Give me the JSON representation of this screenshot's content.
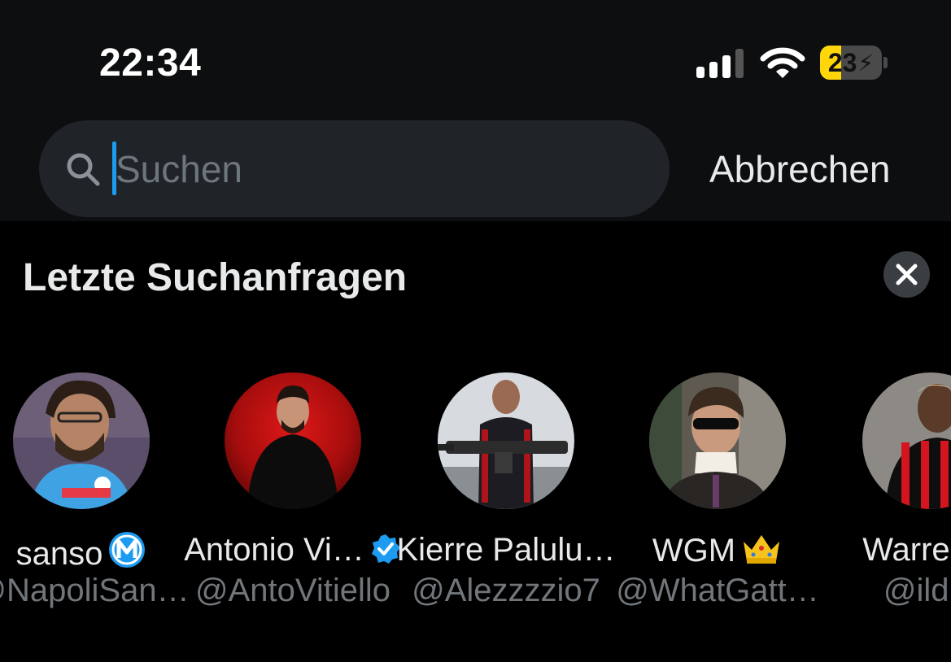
{
  "status_bar": {
    "time": "22:34",
    "battery_level": "23",
    "battery_color": "#ffd60a"
  },
  "search": {
    "placeholder": "Suchen",
    "value": "",
    "cancel_label": "Abbrechen",
    "accent": "#1d9bf0"
  },
  "recent": {
    "title": "Letzte Suchanfragen",
    "clear_icon": "close-icon",
    "items": [
      {
        "name": "sanso",
        "handle": "@NapoliSan…",
        "badge": "m-badge-icon"
      },
      {
        "name": "Antonio Vi…",
        "handle": "@AntoVitiello",
        "badge": "verified-icon"
      },
      {
        "name": "Kierre Palulu…",
        "handle": "@Alezzzzio7",
        "badge": ""
      },
      {
        "name": "WGM",
        "handle": "@WhatGatt…",
        "badge": "crown-emoji-icon"
      },
      {
        "name": "Warren E",
        "handle": "@ildur",
        "badge": ""
      }
    ]
  }
}
